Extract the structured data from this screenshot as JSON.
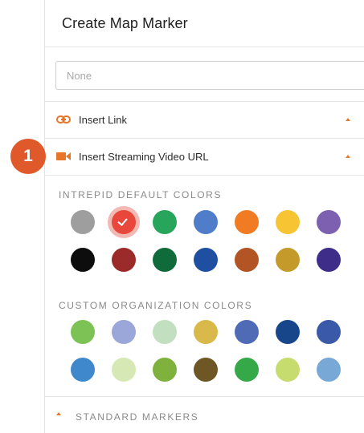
{
  "panel": {
    "title": "Create Map Marker",
    "input_placeholder": "None",
    "rows": [
      {
        "label": "Insert Link",
        "icon": "link-icon"
      },
      {
        "label": "Insert Streaming Video URL",
        "icon": "video-camera-icon"
      }
    ],
    "step_badge": "1",
    "default_colors_header": "INTREPID DEFAULT COLORS",
    "custom_colors_header": "CUSTOM ORGANIZATION COLORS",
    "standard_markers_label": "STANDARD MARKERS"
  },
  "colors": {
    "accent": "#e8762a",
    "badge": "#e0592a",
    "default": [
      "#9e9e9e",
      "#e8473b",
      "#27a55a",
      "#4f7dc9",
      "#f07b22",
      "#f7c434",
      "#7d60b0",
      "#0d0d0d",
      "#9b2a2a",
      "#0f6b3a",
      "#1e4fa1",
      "#b35424",
      "#c49b2a",
      "#3f2d8a"
    ],
    "custom": [
      "#7cc255",
      "#9aa7d8",
      "#c2e0bf",
      "#d9b94a",
      "#4f6bb5",
      "#17478a",
      "#3a59a8",
      "#3f88cc",
      "#d6e8b4",
      "#7fb23c",
      "#6e5724",
      "#35a848",
      "#c6dc6e",
      "#78a8d6"
    ],
    "selected_default_index": 1
  }
}
